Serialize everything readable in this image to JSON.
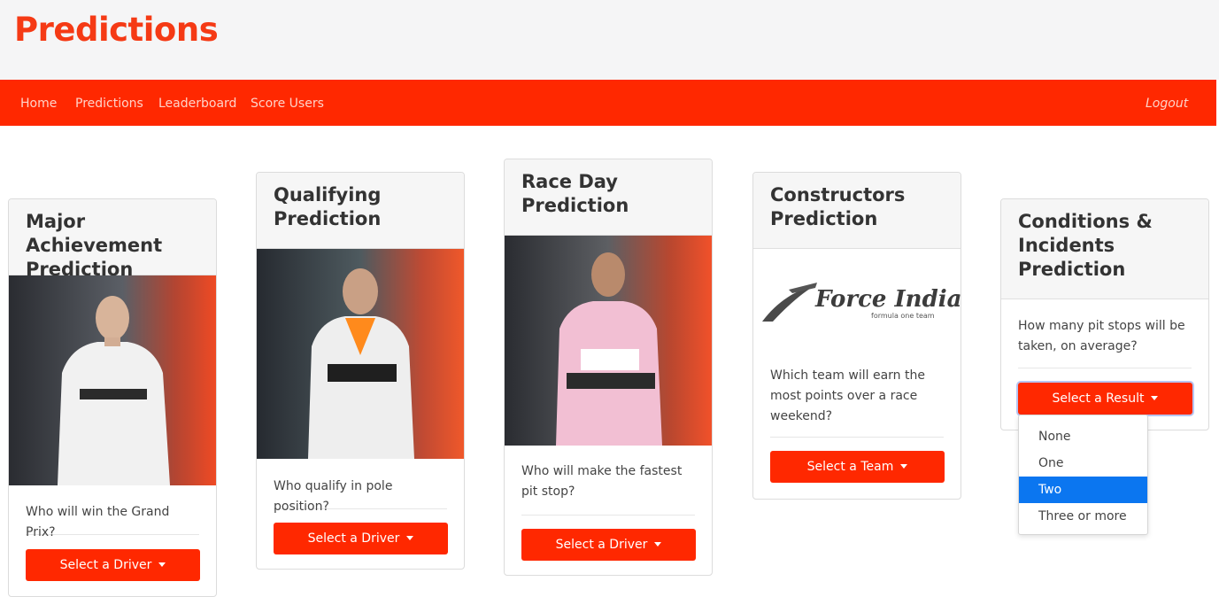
{
  "header": {
    "title": "Predictions"
  },
  "nav": {
    "links": [
      "Home",
      "Predictions",
      "Leaderboard",
      "Score Users"
    ],
    "logout": "Logout"
  },
  "cards": [
    {
      "title": "Major Achievement Prediction",
      "question": "Who will win the Grand Prix?",
      "button": "Select a Driver",
      "image": "driver-portrait-white-suit"
    },
    {
      "title": "Qualifying Prediction",
      "question": "Who qualify in pole position?",
      "button": "Select a Driver",
      "image": "driver-portrait-orange-suit"
    },
    {
      "title": "Race Day Prediction",
      "question": "Who will make the fastest pit stop?",
      "button": "Select a Driver",
      "image": "driver-portrait-pink-suit"
    },
    {
      "title": "Constructors Prediction",
      "question": "Which team will earn the most points over a race weekend?",
      "button": "Select a Team",
      "logo": {
        "name": "Force India",
        "tagline": "formula one team"
      }
    },
    {
      "title": "Conditions & Incidents Prediction",
      "question": "How many pit stops will be taken, on average?",
      "button": "Select a Result"
    }
  ],
  "dropdown": {
    "options": [
      "None",
      "One",
      "Two",
      "Three or more"
    ],
    "selected": "Two"
  },
  "colors": {
    "brand_red": "#ff2800",
    "title_red": "#f53a15",
    "highlight_blue": "#0b76f0"
  }
}
